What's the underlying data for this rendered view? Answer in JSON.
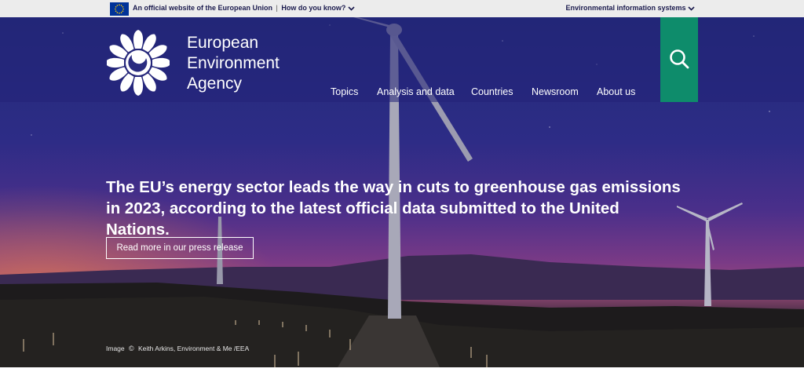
{
  "eu_bar": {
    "official_text": "An official website of the European Union",
    "separator": "|",
    "how_link": "How do you know?",
    "systems_link": "Environmental information systems"
  },
  "brand": {
    "line1": "European",
    "line2": "Environment",
    "line3": "Agency"
  },
  "nav": {
    "items": [
      {
        "label": "Topics"
      },
      {
        "label": "Analysis and data"
      },
      {
        "label": "Countries"
      },
      {
        "label": "Newsroom"
      },
      {
        "label": "About us"
      }
    ]
  },
  "search": {
    "icon": "search-icon"
  },
  "hero": {
    "headline": "The EU’s energy sector leads the way in cuts to greenhouse gas emissions in 2023, according to the latest official data submitted to the United Nations.",
    "cta_label": "Read more in our press release",
    "credit_prefix": "Image",
    "credit_symbol": "©",
    "credit_text": "Keith Arkins, Environment & Me /EEA"
  },
  "colors": {
    "eu_bar": "#ececec",
    "header_band": "#222278",
    "search_button": "#0e8c6b",
    "text": "#ffffff"
  }
}
